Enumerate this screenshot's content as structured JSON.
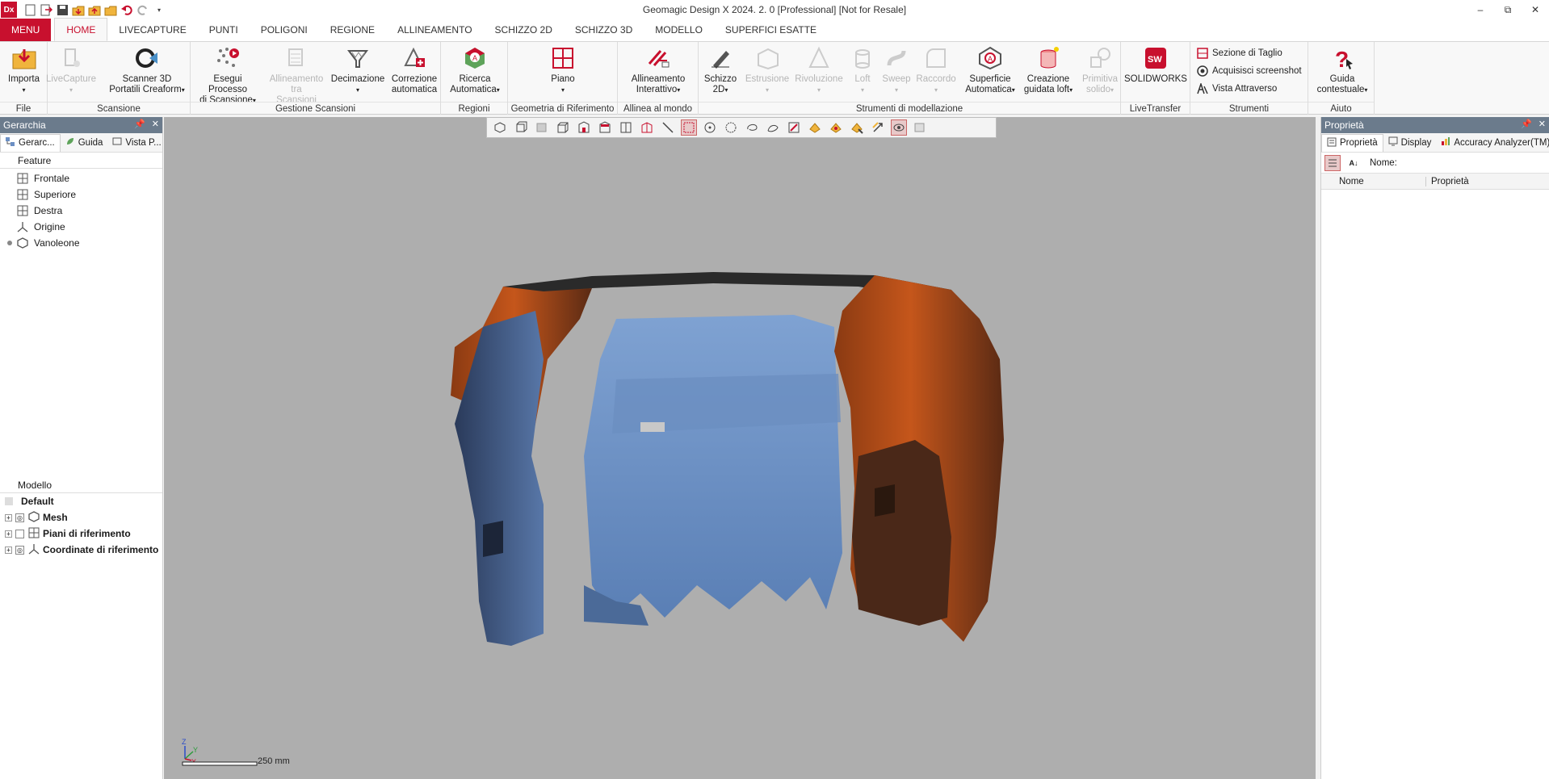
{
  "app": {
    "logo": "Dx",
    "title": "Geomagic Design X 2024. 2. 0 [Professional] [Not for Resale]"
  },
  "qat_icons": [
    "new-file-icon",
    "open-icon",
    "save-icon",
    "import-icon",
    "export-icon",
    "open-folder-icon",
    "undo-icon",
    "redo-icon",
    "customize-icon"
  ],
  "ribbon_tabs": [
    "MENU",
    "HOME",
    "LIVECAPTURE",
    "PUNTI",
    "POLIGONI",
    "REGIONE",
    "ALLINEAMENTO",
    "SCHIZZO 2D",
    "SCHIZZO 3D",
    "MODELLO",
    "SUPERFICI ESATTE"
  ],
  "ribbon": {
    "groups": {
      "file": "File",
      "scansione": "Scansione",
      "gestione": "Gestione Scansioni",
      "regioni": "Regioni",
      "geometria": "Geometria di Riferimento",
      "allinea": "Allinea al mondo",
      "strumenti_mod": "Strumenti di modellazione",
      "livetransfer": "LiveTransfer",
      "strumenti": "Strumenti",
      "aiuto": "Aiuto"
    },
    "buttons": {
      "importa": "Importa",
      "livecapture": "LiveCapture",
      "scanner_1": "Scanner 3D",
      "scanner_2": "Portatili Creaform",
      "esegui_1": "Esegui Processo",
      "esegui_2": "di Scansione",
      "allineamento_1": "Allineamento",
      "allineamento_2": "tra Scansioni",
      "decimazione": "Decimazione",
      "correzione_1": "Correzione",
      "correzione_2": "automatica",
      "ricerca_1": "Ricerca",
      "ricerca_2": "Automatica",
      "piano": "Piano",
      "allint_1": "Allineamento",
      "allint_2": "Interattivo",
      "schizzo_1": "Schizzo",
      "schizzo_2": "2D",
      "estrusione": "Estrusione",
      "rivoluzione": "Rivoluzione",
      "loft": "Loft",
      "sweep": "Sweep",
      "raccordo": "Raccordo",
      "superficie_1": "Superficie",
      "superficie_2": "Automatica",
      "creazione_1": "Creazione",
      "creazione_2": "guidata loft",
      "primitiva_1": "Primitiva",
      "primitiva_2": "solido",
      "solidworks": "SOLIDWORKS",
      "sezione": "Sezione di Taglio",
      "screenshot": "Acquisisci screenshot",
      "vista": "Vista Attraverso",
      "guida_1": "Guida",
      "guida_2": "contestuale"
    }
  },
  "left_panel": {
    "title": "Gerarchia",
    "tabs": [
      "Gerarc...",
      "Guida",
      "Vista P..."
    ],
    "feature_label": "Feature",
    "features": [
      "Frontale",
      "Superiore",
      "Destra",
      "Origine",
      "Vanoleone"
    ],
    "model_label": "Modello",
    "default_label": "Default",
    "model_items": [
      "Mesh",
      "Piani di riferimento",
      "Coordinate di riferimento"
    ]
  },
  "viewport": {
    "scale_text": "250 mm",
    "axes": {
      "x": "X",
      "y": "Y",
      "z": "Z"
    },
    "mesh_colors": {
      "blue": "#6f93c4",
      "orange": "#c5561b",
      "background": "#aeaeae"
    }
  },
  "right_panel": {
    "title": "Proprietà",
    "tabs": [
      "Proprietà",
      "Display",
      "Accuracy Analyzer(TM)"
    ],
    "name_label": "Nome:",
    "columns": [
      "Nome",
      "Proprietà"
    ]
  },
  "colors": {
    "accent": "#c8102e",
    "panel_header": "#6b7b8c"
  }
}
